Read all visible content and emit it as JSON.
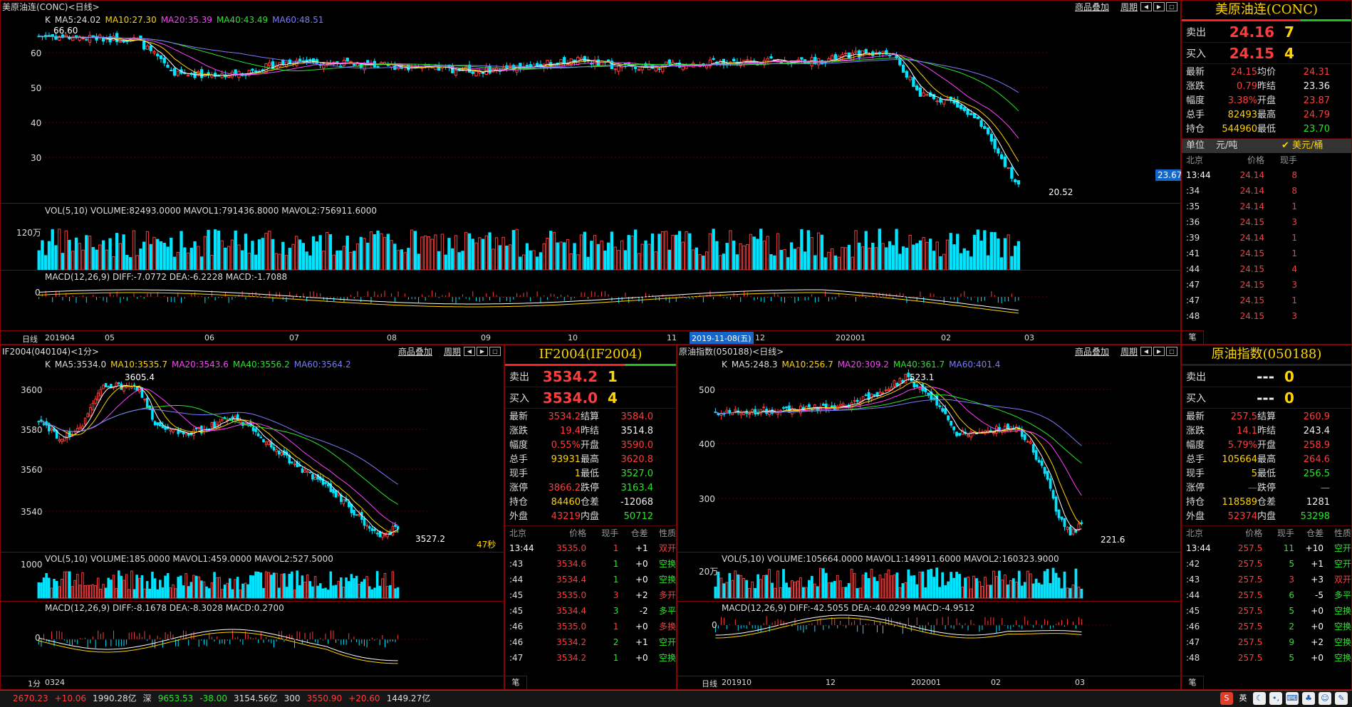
{
  "tl": {
    "title": "美原油连(CONC)<日线>",
    "links": [
      "商品叠加",
      "周期"
    ],
    "legend": [
      {
        "t": "K",
        "c": "#dddddd"
      },
      {
        "t": "MA5:24.02",
        "c": "#dddddd"
      },
      {
        "t": "MA10:27.30",
        "c": "#ffd400"
      },
      {
        "t": "MA20:35.39",
        "c": "#ff40ff"
      },
      {
        "t": "MA40:43.49",
        "c": "#28e628"
      },
      {
        "t": "MA60:48.51",
        "c": "#7b7bff"
      }
    ],
    "yticks": [
      "60",
      "50",
      "40",
      "30"
    ],
    "max_label": "66.60",
    "min_label": "20.52",
    "cur_label": "23.67",
    "vol_legend": "VOL(5,10) VOLUME:82493.0000 MAVOL1:791436.8000 MAVOL2:756911.6000",
    "vol_tick": "120万",
    "macd_legend": "MACD(12,26,9) DIFF:-7.0772 DEA:-6.2228 MACD:-1.7088",
    "macd_tick": "0",
    "period": "日线",
    "xticks": [
      "201904",
      "05",
      "06",
      "07",
      "08",
      "09",
      "10",
      "11",
      "12",
      "202001",
      "02",
      "03"
    ],
    "cursor_date": "2019-11-08(五)"
  },
  "tq": {
    "title": "美原油连(CONC)",
    "sell": {
      "label": "卖出",
      "price": "24.16",
      "vol": "7"
    },
    "buy": {
      "label": "买入",
      "price": "24.15",
      "vol": "4"
    },
    "stats": [
      [
        "最新",
        "24.15",
        "均价",
        "24.31"
      ],
      [
        "涨跌",
        "0.79",
        "昨结",
        "23.36"
      ],
      [
        "幅度",
        "3.38%",
        "开盘",
        "23.87"
      ],
      [
        "总手",
        "82493",
        "最高",
        "24.79"
      ],
      [
        "持仓",
        "544960",
        "最低",
        "23.70"
      ]
    ],
    "unit": {
      "label": "单位",
      "a": "元/吨",
      "b": "✔ 美元/桶"
    },
    "tick_head": [
      "北京",
      "价格",
      "现手"
    ],
    "ticks": [
      [
        "13:44",
        "24.14",
        "8"
      ],
      [
        ":34",
        "24.14",
        "8"
      ],
      [
        ":35",
        "24.14",
        "1"
      ],
      [
        ":36",
        "24.15",
        "3"
      ],
      [
        ":39",
        "24.14",
        "1"
      ],
      [
        ":41",
        "24.15",
        "1"
      ],
      [
        ":44",
        "24.15",
        "4"
      ],
      [
        ":47",
        "24.15",
        "3"
      ],
      [
        ":47",
        "24.15",
        "1"
      ],
      [
        ":48",
        "24.15",
        "3"
      ]
    ],
    "footer": "笔"
  },
  "bl": {
    "title": "IF2004(040104)<1分>",
    "links": [
      "商品叠加",
      "周期"
    ],
    "legend": [
      {
        "t": "K",
        "c": "#dddddd"
      },
      {
        "t": "MA5:3534.0",
        "c": "#dddddd"
      },
      {
        "t": "MA10:3535.7",
        "c": "#ffd400"
      },
      {
        "t": "MA20:3543.6",
        "c": "#ff40ff"
      },
      {
        "t": "MA40:3556.2",
        "c": "#28e628"
      },
      {
        "t": "MA60:3564.2",
        "c": "#7b7bff"
      }
    ],
    "yticks": [
      "3600",
      "3580",
      "3560",
      "3540"
    ],
    "max_label": "3605.4",
    "min_label": "3527.2",
    "countdown": "47秒",
    "vol_legend": "VOL(5,10) VOLUME:185.0000 MAVOL1:459.0000 MAVOL2:527.5000",
    "vol_tick": "1000",
    "macd_legend": "MACD(12,26,9) DIFF:-8.1678 DEA:-8.3028 MACD:0.2700",
    "macd_tick": "0",
    "period": "1分",
    "xticks": [
      "0324"
    ]
  },
  "bq": {
    "title": "IF2004(IF2004)",
    "sell": {
      "label": "卖出",
      "price": "3534.2",
      "vol": "1"
    },
    "buy": {
      "label": "买入",
      "price": "3534.0",
      "vol": "4"
    },
    "stats": [
      [
        "最新",
        "3534.2",
        "结算",
        "3584.0"
      ],
      [
        "涨跌",
        "19.4",
        "昨结",
        "3514.8"
      ],
      [
        "幅度",
        "0.55%",
        "开盘",
        "3590.0"
      ],
      [
        "总手",
        "93931",
        "最高",
        "3620.8"
      ],
      [
        "现手",
        "1",
        "最低",
        "3527.0"
      ],
      [
        "涨停",
        "3866.2",
        "跌停",
        "3163.4"
      ],
      [
        "持仓",
        "84460",
        "仓差",
        "-12068"
      ],
      [
        "外盘",
        "43219",
        "内盘",
        "50712"
      ]
    ],
    "tick_head": [
      "北京",
      "价格",
      "现手",
      "仓差",
      "性质"
    ],
    "ticks": [
      [
        "13:44",
        "3535.0",
        "1",
        "+1",
        "双开"
      ],
      [
        ":43",
        "3534.6",
        "1",
        "+0",
        "空换"
      ],
      [
        ":44",
        "3534.4",
        "1",
        "+0",
        "空换"
      ],
      [
        ":45",
        "3535.0",
        "3",
        "+2",
        "多开"
      ],
      [
        ":45",
        "3534.4",
        "3",
        "-2",
        "多平"
      ],
      [
        ":46",
        "3535.0",
        "1",
        "+0",
        "多换"
      ],
      [
        ":46",
        "3534.2",
        "2",
        "+1",
        "空开"
      ],
      [
        ":47",
        "3534.2",
        "1",
        "+0",
        "空换"
      ]
    ],
    "footer": "笔"
  },
  "br": {
    "title": "原油指数(050188)<日线>",
    "links": [
      "商品叠加",
      "周期"
    ],
    "legend": [
      {
        "t": "K",
        "c": "#dddddd"
      },
      {
        "t": "MA5:248.3",
        "c": "#dddddd"
      },
      {
        "t": "MA10:256.7",
        "c": "#ffd400"
      },
      {
        "t": "MA20:309.2",
        "c": "#ff40ff"
      },
      {
        "t": "MA40:361.7",
        "c": "#28e628"
      },
      {
        "t": "MA60:401.4",
        "c": "#7b7bff"
      }
    ],
    "yticks": [
      "500",
      "400",
      "300"
    ],
    "max_label": "523.1",
    "min_label": "221.6",
    "vol_legend": "VOL(5,10) VOLUME:105664.0000 MAVOL1:149911.6000 MAVOL2:160323.9000",
    "vol_tick": "20万",
    "macd_legend": "MACD(12,26,9) DIFF:-42.5055 DEA:-40.0299 MACD:-4.9512",
    "macd_tick": "0",
    "period": "日线",
    "xticks": [
      "201910",
      "12",
      "202001",
      "02",
      "03"
    ]
  },
  "brq": {
    "title": "原油指数(050188)",
    "sell": {
      "label": "卖出",
      "price": "---",
      "vol": "0"
    },
    "buy": {
      "label": "买入",
      "price": "---",
      "vol": "0"
    },
    "stats": [
      [
        "最新",
        "257.5",
        "结算",
        "260.9"
      ],
      [
        "涨跌",
        "14.1",
        "昨结",
        "243.4"
      ],
      [
        "幅度",
        "5.79%",
        "开盘",
        "258.9"
      ],
      [
        "总手",
        "105664",
        "最高",
        "264.6"
      ],
      [
        "现手",
        "5",
        "最低",
        "256.5"
      ],
      [
        "涨停",
        "—",
        "跌停",
        "—"
      ],
      [
        "持仓",
        "118589",
        "仓差",
        "1281"
      ],
      [
        "外盘",
        "52374",
        "内盘",
        "53298"
      ]
    ],
    "tick_head": [
      "北京",
      "价格",
      "现手",
      "仓差",
      "性质"
    ],
    "ticks": [
      [
        "13:44",
        "257.5",
        "11",
        "+10",
        "空开"
      ],
      [
        ":42",
        "257.5",
        "5",
        "+1",
        "空开"
      ],
      [
        ":43",
        "257.5",
        "3",
        "+3",
        "双开"
      ],
      [
        ":44",
        "257.5",
        "6",
        "-5",
        "多平"
      ],
      [
        ":45",
        "257.5",
        "5",
        "+0",
        "空换"
      ],
      [
        ":46",
        "257.5",
        "2",
        "+0",
        "空换"
      ],
      [
        ":47",
        "257.5",
        "9",
        "+2",
        "空换"
      ],
      [
        ":48",
        "257.5",
        "5",
        "+0",
        "空换"
      ]
    ],
    "footer": "笔"
  },
  "status": [
    {
      "t": "2670.23",
      "c": "#ff3c3c"
    },
    {
      "t": "+10.06",
      "c": "#ff3c3c"
    },
    {
      "t": "1990.28亿",
      "c": "#dddddd"
    },
    {
      "t": "深",
      "c": "#dddddd"
    },
    {
      "t": "9653.53",
      "c": "#28e628"
    },
    {
      "t": "-38.00",
      "c": "#28e628"
    },
    {
      "t": "3154.56亿",
      "c": "#dddddd"
    },
    {
      "t": "300",
      "c": "#dddddd"
    },
    {
      "t": "3550.90",
      "c": "#ff3c3c"
    },
    {
      "t": "+20.60",
      "c": "#ff3c3c"
    },
    {
      "t": "1449.27亿",
      "c": "#dddddd"
    }
  ],
  "ime_label": "英"
}
